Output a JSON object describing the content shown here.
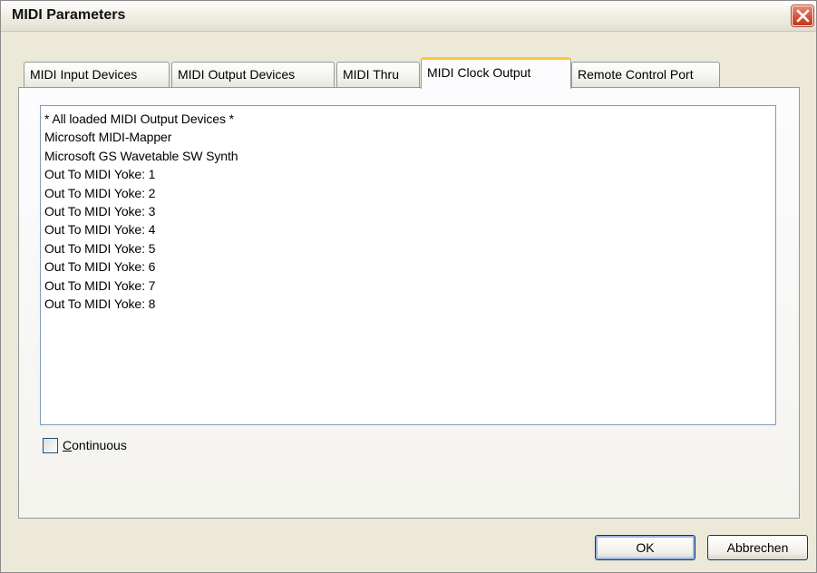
{
  "window": {
    "title": "MIDI Parameters"
  },
  "tabs": [
    {
      "label": "MIDI Input Devices"
    },
    {
      "label": "MIDI Output Devices"
    },
    {
      "label": "MIDI Thru"
    },
    {
      "label": "MIDI Clock Output",
      "active": true
    },
    {
      "label": "Remote Control Port"
    }
  ],
  "device_list": {
    "items": [
      "* All loaded MIDI Output Devices *",
      "Microsoft MIDI-Mapper",
      "Microsoft GS Wavetable SW Synth",
      "Out To MIDI Yoke:  1",
      "Out To MIDI Yoke:  2",
      "Out To MIDI Yoke:  3",
      "Out To MIDI Yoke:  4",
      "Out To MIDI Yoke:  5",
      "Out To MIDI Yoke:  6",
      "Out To MIDI Yoke:  7",
      "Out To MIDI Yoke:  8"
    ]
  },
  "continuous": {
    "label_accel": "C",
    "label_rest": "ontinuous",
    "checked": false
  },
  "buttons": {
    "ok": "OK",
    "cancel": "Abbrechen"
  },
  "colors": {
    "active_tab_accent": "#ffc83c",
    "close_button": "#d6553a"
  }
}
